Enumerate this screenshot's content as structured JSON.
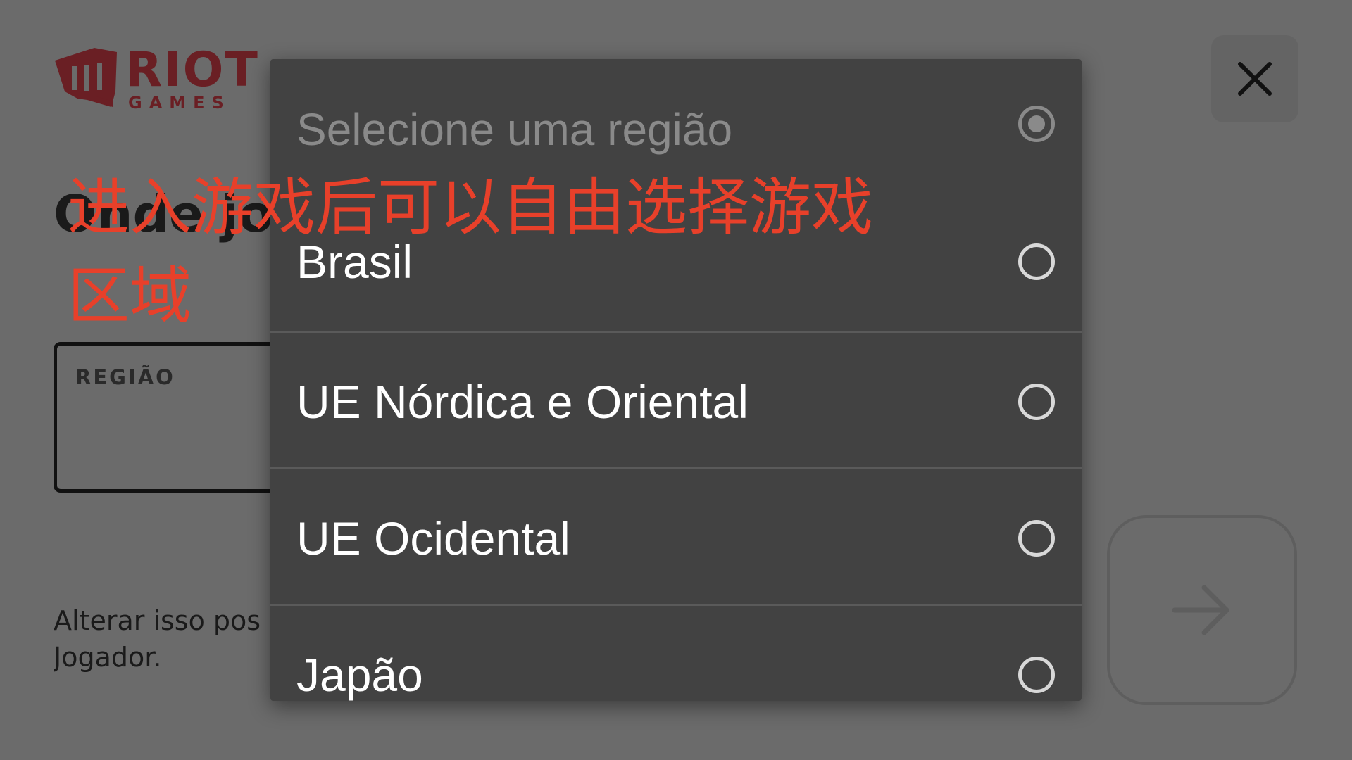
{
  "logo": {
    "line1": "RIOT",
    "line2": "GAMES",
    "color": "#6a1f24"
  },
  "background": {
    "heading_partial": "Onde jo",
    "region_label": "REGIÃO",
    "note_line1": "Alterar isso pos",
    "note_line2": "Jogador."
  },
  "buttons": {
    "close_icon": "close-icon",
    "next_icon": "arrow-right-icon"
  },
  "region_picker": {
    "prompt": "Selecione uma região",
    "options": [
      {
        "label": "Brasil",
        "selected": false
      },
      {
        "label": "UE Nórdica e Oriental",
        "selected": false
      },
      {
        "label": "UE Ocidental",
        "selected": false
      },
      {
        "label": "Japão",
        "selected": false
      }
    ]
  },
  "annotation": {
    "text": "进入游戏后可以自由选择游戏区域",
    "color": "#e8402a"
  }
}
